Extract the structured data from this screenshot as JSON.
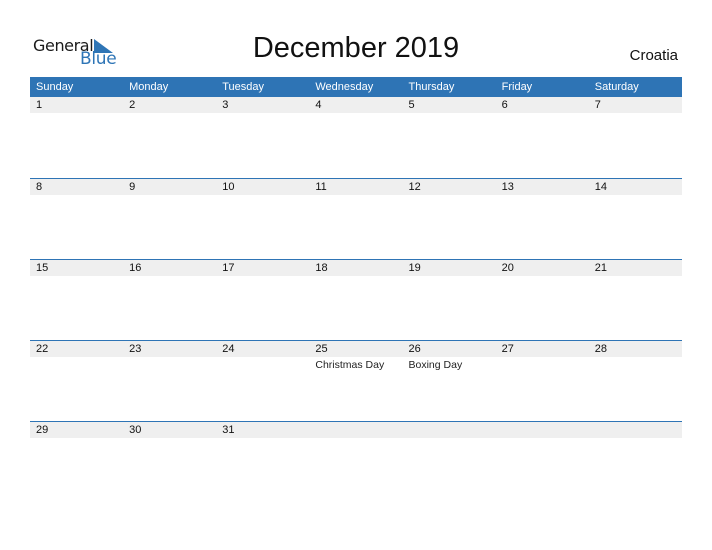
{
  "logo": {
    "line1": "General",
    "line2": "Blue"
  },
  "title": "December 2019",
  "country": "Croatia",
  "colors": {
    "accent": "#2e74b5",
    "row_bg": "#efefef"
  },
  "weekdays": [
    "Sunday",
    "Monday",
    "Tuesday",
    "Wednesday",
    "Thursday",
    "Friday",
    "Saturday"
  ],
  "weeks": [
    {
      "days": [
        "1",
        "2",
        "3",
        "4",
        "5",
        "6",
        "7"
      ],
      "holidays": [
        "",
        "",
        "",
        "",
        "",
        "",
        ""
      ]
    },
    {
      "days": [
        "8",
        "9",
        "10",
        "11",
        "12",
        "13",
        "14"
      ],
      "holidays": [
        "",
        "",
        "",
        "",
        "",
        "",
        ""
      ]
    },
    {
      "days": [
        "15",
        "16",
        "17",
        "18",
        "19",
        "20",
        "21"
      ],
      "holidays": [
        "",
        "",
        "",
        "",
        "",
        "",
        ""
      ]
    },
    {
      "days": [
        "22",
        "23",
        "24",
        "25",
        "26",
        "27",
        "28"
      ],
      "holidays": [
        "",
        "",
        "",
        "Christmas Day",
        "Boxing Day",
        "",
        ""
      ]
    },
    {
      "days": [
        "29",
        "30",
        "31",
        "",
        "",
        "",
        ""
      ],
      "holidays": [
        "",
        "",
        "",
        "",
        "",
        "",
        ""
      ]
    }
  ]
}
